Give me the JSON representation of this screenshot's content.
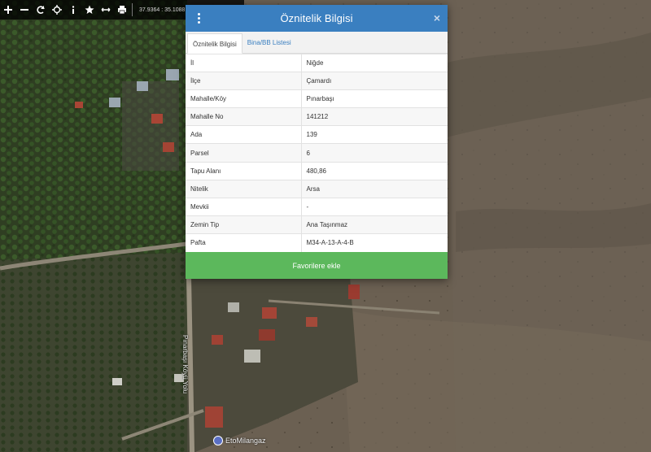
{
  "toolbar": {
    "icons": [
      "plus-icon",
      "minus-icon",
      "refresh-icon",
      "crosshair-icon",
      "info-icon",
      "star-icon",
      "measure-icon",
      "print-icon"
    ],
    "coordinates": "37.9364 : 35.1088"
  },
  "modal": {
    "title": "Öznitelik Bilgisi",
    "tabs": [
      {
        "label": "Öznitelik Bilgisi",
        "active": true
      },
      {
        "label": "Bina/BB Listesi",
        "active": false
      }
    ],
    "rows": [
      {
        "key": "İl",
        "value": "Niğde"
      },
      {
        "key": "İlçe",
        "value": "Çamardı"
      },
      {
        "key": "Mahalle/Köy",
        "value": "Pınarbaşı"
      },
      {
        "key": "Mahalle No",
        "value": "141212"
      },
      {
        "key": "Ada",
        "value": "139"
      },
      {
        "key": "Parsel",
        "value": "6"
      },
      {
        "key": "Tapu Alanı",
        "value": "480,86"
      },
      {
        "key": "Nitelik",
        "value": "Arsa"
      },
      {
        "key": "Mevkii",
        "value": "-"
      },
      {
        "key": "Zemin Tip",
        "value": "Ana Taşınmaz"
      },
      {
        "key": "Pafta",
        "value": "M34-A-13-A-4-B"
      }
    ],
    "favorite_button": "Favorilere ekle"
  },
  "map": {
    "road_label": "Pınarbaşı Köyü Yolu",
    "poi_label": "EtoMilangaz"
  },
  "colors": {
    "header": "#3a7fc0",
    "button": "#5cb85c",
    "tab_link": "#3a7fc0"
  }
}
